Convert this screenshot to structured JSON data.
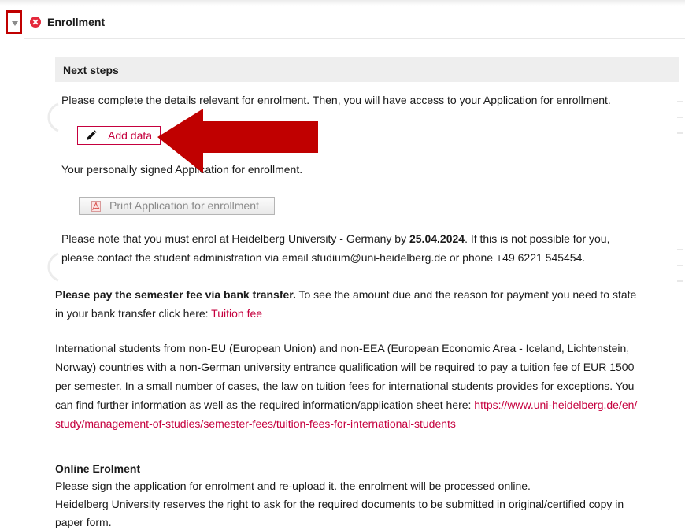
{
  "section": {
    "title": "Enrollment",
    "toggle_icon": "collapse-triangle-icon",
    "status_icon": "error-x-icon"
  },
  "next_steps": {
    "title": "Next steps",
    "intro": "Please complete the details relevant for enrolment. Then, you will have access to your Application for enrollment.",
    "add_data_label": "Add data",
    "signed_text": "Your personally signed Application for enrollment.",
    "print_label": "Print Application for enrollment",
    "deadline_pre": "Please note that you must enrol at Heidelberg University - Germany by ",
    "deadline_date": "25.04.2024",
    "deadline_post": ". If this is not possible for you,",
    "contact": "please contact the student administration via email studium@uni-heidelberg.de or phone +49 6221 545454."
  },
  "fee": {
    "bold": "Please pay the semester fee via bank transfer.",
    "rest": " To see the amount due and the reason for payment you need to state",
    "line2_pre": "in your bank transfer click here: ",
    "link": "Tuition fee"
  },
  "international": {
    "line1": "International students from non-EU (European Union) and non-EEA (European Economic Area - Iceland, Lichtenstein,",
    "line2": "Norway) countries with a non-German university entrance qualification will be required to pay a tuition fee of EUR 1500",
    "line3": "per semester. In a small number of cases, the law on tuition fees for international students provides for exceptions. You",
    "line4_pre": "can find further information as well as the required information/application sheet here: ",
    "link_part1": "https://www.uni-heidelberg.de/en/",
    "link_part2": "study/management-of-studies/semester-fees/tuition-fees-for-international-students"
  },
  "online": {
    "title": "Online Erolment",
    "line1": "Please sign the application for enrolment and re-upload it. the enrolment will be processed online.",
    "line2": "Heidelberg University reserves the right to ask for the required documents to be submitted in original/certified copy in",
    "line3": "paper form."
  },
  "colors": {
    "accent": "#c5003e",
    "annotation_red": "#c00000",
    "error_red": "#e4283b",
    "bar_gray": "#eeeeee"
  }
}
